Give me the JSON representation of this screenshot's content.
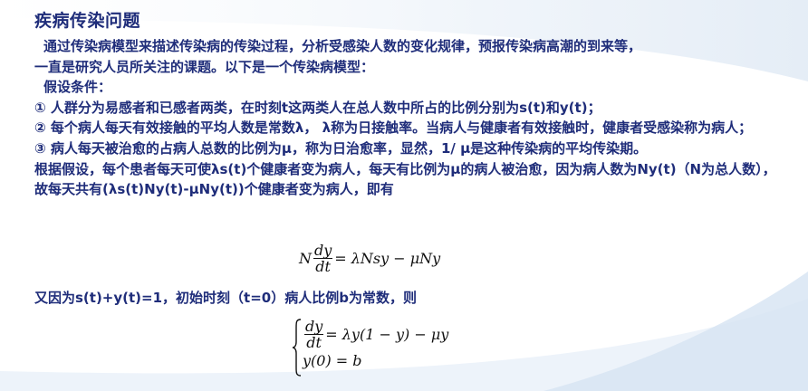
{
  "slide": {
    "title": "疾病传染问题",
    "paragraphs": [
      "通过传染病模型来描述传染病的传染过程，分析受感染人数的变化规律，预报传染病高潮的到来等，",
      "一直是研究人员所关注的课题。以下是一个传染病模型：",
      "假设条件：",
      "① 人群分为易感者和已感者两类，在时刻t这两类人在总人数中所占的比例分别为s(t)和y(t)；",
      "② 每个病人每天有效接触的平均人数是常数λ， λ称为日接触率。当病人与健康者有效接触时，健康者受感染称为病人；",
      "③ 病人每天被治愈的占病人总数的比例为μ，称为日治愈率，显然，1/ μ是这种传染病的平均传染期。",
      "根据假设，每个患者每天可使λs(t)个健康者变为病人，每天有比例为μ的病人被治愈，因为病人数为Ny(t)（N为总人数），故每天共有(λs(t)Ny(t)-μNy(t))个健康者变为病人，即有"
    ],
    "equation1": {
      "lhs_coef": "N",
      "num": "dy",
      "den": "dt",
      "rhs": "= λNsy − μNy"
    },
    "line3": "又因为s(t)+y(t)=1，初始时刻（t=0）病人比例b为常数，则",
    "system": {
      "num": "dy",
      "den": "dt",
      "rhs1": "= λy(1 − y) − μy",
      "row2": "y(0) = b"
    }
  }
}
